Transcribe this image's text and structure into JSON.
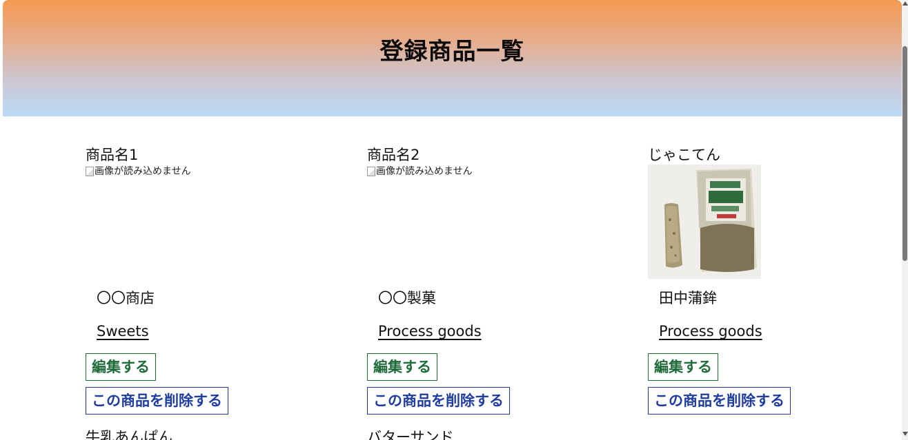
{
  "header": {
    "title": "登録商品一覧"
  },
  "products": [
    {
      "name": "商品名1",
      "image_alt": "画像が読み込めません",
      "shop": "〇〇商店",
      "category": "Sweets",
      "edit_label": "編集する",
      "delete_label": "この商品を削除する"
    },
    {
      "name": "商品名2",
      "image_alt": "画像が読み込めません",
      "shop": "〇〇製菓",
      "category": "Process goods",
      "edit_label": "編集する",
      "delete_label": "この商品を削除する"
    },
    {
      "name": "じゃこてん",
      "image_alt": "",
      "shop": "田中蒲鉾",
      "category": "Process goods",
      "edit_label": "編集する",
      "delete_label": "この商品を削除する"
    }
  ],
  "next_row": [
    {
      "name": "牛乳あんぱん"
    },
    {
      "name": "バターサンド"
    }
  ],
  "colors": {
    "edit_button": "#1f6b3a",
    "delete_button": "#1f3c9f",
    "header_top": "#f29a52",
    "header_bottom": "#bcd9f8"
  }
}
